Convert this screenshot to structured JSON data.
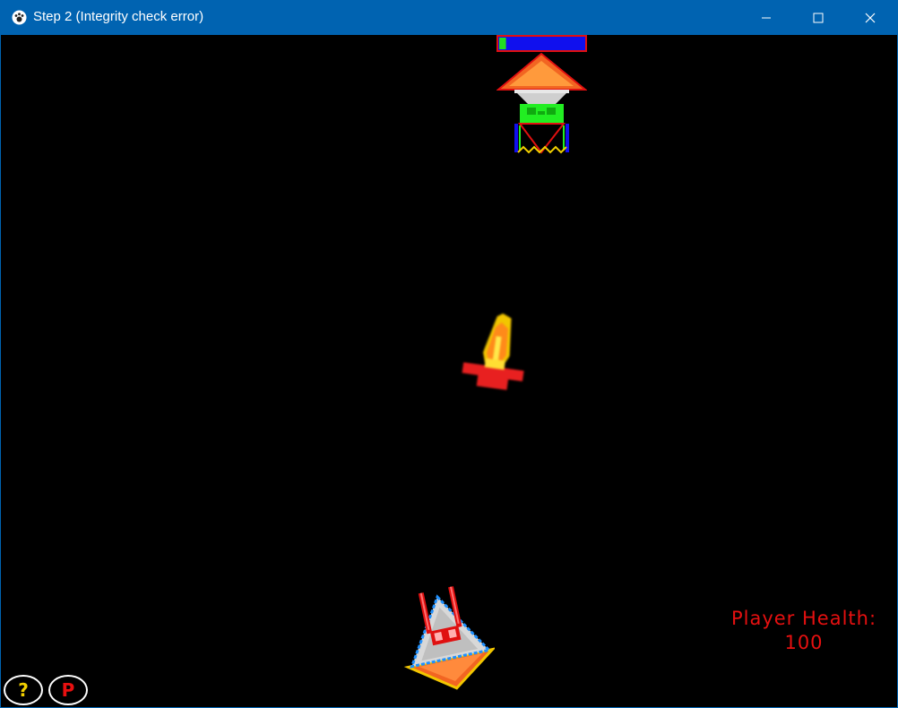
{
  "window": {
    "title": "Step 2 (Integrity check error)",
    "icon": "paw-icon",
    "controls": [
      "minimize-icon",
      "maximize-icon",
      "close-icon"
    ]
  },
  "boss": {
    "health_fraction": 0.08,
    "health_bar_colors": {
      "fill": "#22dd22",
      "empty": "#1010ee",
      "border": "#e01010"
    }
  },
  "player": {
    "health_label": "Player Health:",
    "health_value": "100"
  },
  "buttons": {
    "help_label": "?",
    "pause_label": "P"
  },
  "colors": {
    "titlebar": "#0063b1",
    "background": "#000000",
    "hud_text": "#e61010",
    "help_text": "#f2d000",
    "pause_text": "#e81010"
  }
}
